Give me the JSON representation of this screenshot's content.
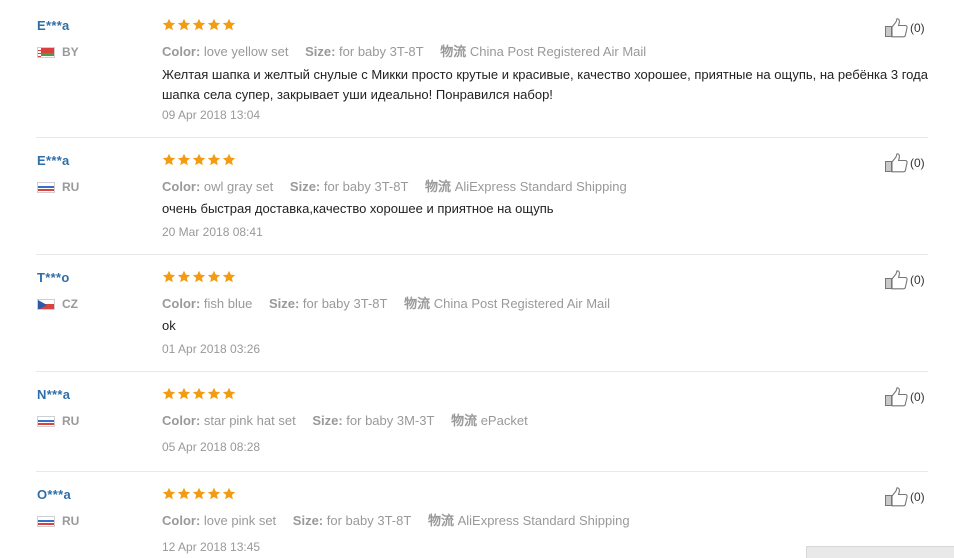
{
  "labels": {
    "color": "Color:",
    "size": "Size:",
    "shipping": "物流"
  },
  "rating_color": "#f39c12",
  "reviews": [
    {
      "name": "E***a",
      "country": "BY",
      "rating": 5,
      "color": "love yellow set",
      "size": "for baby 3T-8T",
      "shipping": "China Post Registered Air Mail",
      "text": "Желтая шапка и желтый снулые с Микки просто крутые и красивые, качество хорошее, приятные на ощупь, на ребёнка 3 года шапка села супер, закрывает уши идеально! Понравился набор!",
      "date": "09 Apr 2018 13:04",
      "helpful": "(0)"
    },
    {
      "name": "E***a",
      "country": "RU",
      "rating": 5,
      "color": "owl gray set",
      "size": "for baby 3T-8T",
      "shipping": "AliExpress Standard Shipping",
      "text": "очень быстрая доставка,качество хорошее и приятное на ощупь",
      "date": "20 Mar 2018 08:41",
      "helpful": "(0)"
    },
    {
      "name": "T***o",
      "country": "CZ",
      "rating": 5,
      "color": "fish blue",
      "size": "for baby 3T-8T",
      "shipping": "China Post Registered Air Mail",
      "text": "ok",
      "date": "01 Apr 2018 03:26",
      "helpful": "(0)"
    },
    {
      "name": "N***a",
      "country": "RU",
      "rating": 5,
      "color": "star pink hat set",
      "size": "for baby 3M-3T",
      "shipping": "ePacket",
      "text": "",
      "date": "05 Apr 2018 08:28",
      "helpful": "(0)"
    },
    {
      "name": "O***a",
      "country": "RU",
      "rating": 5,
      "color": "love pink set",
      "size": "for baby 3T-8T",
      "shipping": "AliExpress Standard Shipping",
      "text": "",
      "date": "12 Apr 2018 13:45",
      "helpful": "(0)"
    }
  ]
}
